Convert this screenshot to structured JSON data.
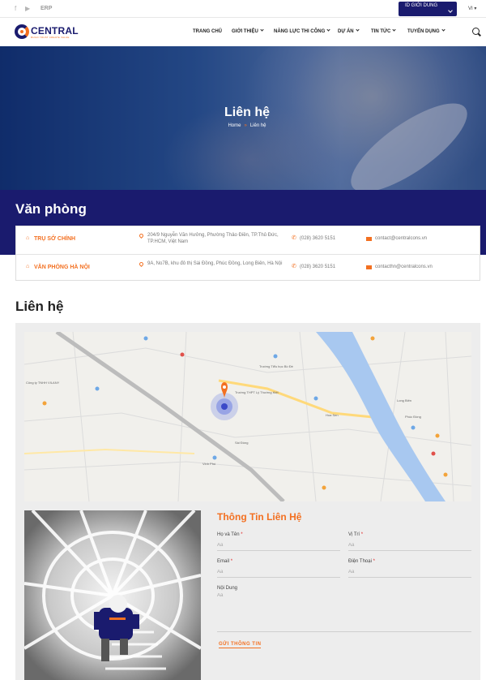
{
  "topbar": {
    "erp": "ERP",
    "region_label": "ID GIỚI DUNG",
    "lang": "VI"
  },
  "header": {
    "logo_word": "CENTRAL",
    "logo_tagline": "BUILD TRUST CREATE VALUE",
    "nav": [
      "TRANG CHỦ",
      "GIỚI THIỆU",
      "NĂNG LỰC THI CÔNG",
      "DỰ ÁN",
      "TIN TỨC",
      "TUYỂN DỤNG"
    ]
  },
  "hero": {
    "title": "Liên hệ",
    "breadcrumb_home": "Home",
    "breadcrumb_current": "Liên hệ"
  },
  "offices": {
    "title": "Văn phòng",
    "rows": [
      {
        "name": "TRỤ SỞ CHÍNH",
        "address": "204/9 Nguyễn Văn Hưởng, Phường Thảo Điền, TP.Thủ Đức, TP.HCM, Việt Nam",
        "phone": "(028) 3620 5151",
        "email": "contact@centralcons.vn"
      },
      {
        "name": "VĂN PHÒNG HÀ NỘI",
        "address": "9A, No7B, khu đô thị Sài Đồng, Phúc Đồng, Long Biên, Hà Nội",
        "phone": "(028) 3620 5151",
        "email": "contacthn@centralcons.vn"
      }
    ]
  },
  "contact": {
    "title": "Liên hệ",
    "form_title": "Thông Tin Liên Hệ",
    "fields": {
      "name_label": "Họ và Tên",
      "position_label": "Vị Trí",
      "email_label": "Email",
      "phone_label": "Điện Thoại",
      "content_label": "Nội Dung",
      "placeholder": "Aa"
    },
    "submit": "GỬI THÔNG TIN"
  },
  "map_labels": [
    "Hoa Sen",
    "Trường Tiểu học Bồ Đề",
    "Long Biên",
    "Sài Đồng",
    "Phúc Đồng",
    "Vinh Phú",
    "Trường THPT Lý Thường Kiệt",
    "Công ty TNHH VILANY"
  ],
  "colors": {
    "navy": "#1a1b6e",
    "orange": "#f37021",
    "river": "#a8c8f0"
  }
}
